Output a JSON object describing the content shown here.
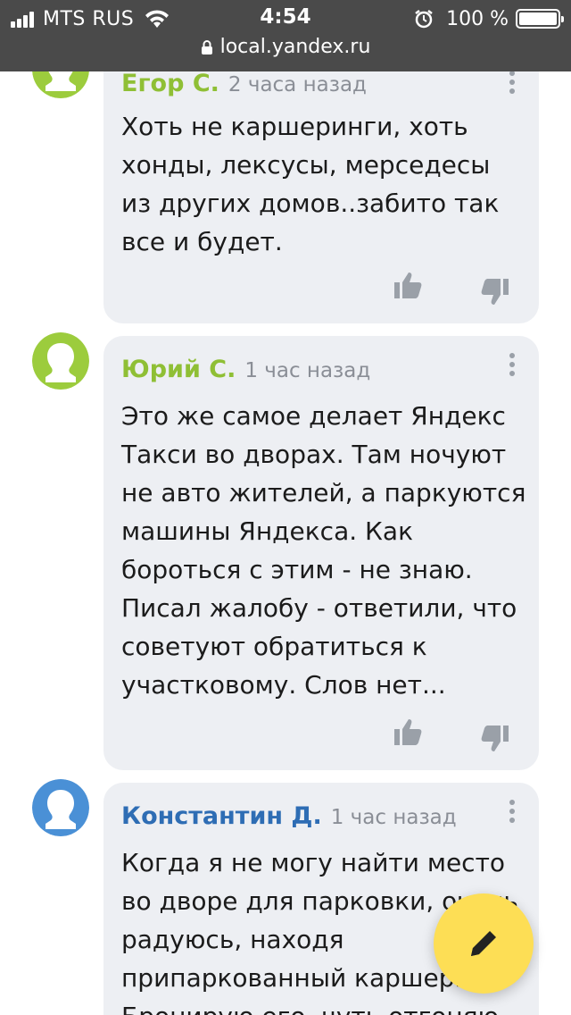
{
  "status_bar": {
    "carrier": "MTS RUS",
    "time": "4:54",
    "battery": "100 %"
  },
  "url_bar": {
    "url": "local.yandex.ru"
  },
  "comments": [
    {
      "author": "Егор С.",
      "age": "2 часа назад",
      "text": "Хоть не каршеринги, хоть\nхонды, лексусы, мерседесы\nиз других домов..забито так\nвсе и будет.",
      "avatar_color": "#9ccc3d",
      "author_color": "#8fbf35"
    },
    {
      "author": "Юрий С.",
      "age": "1 час назад",
      "text": "Это же самое делает Яндекс\nТакси во дворах. Там ночуют\nне авто жителей, а паркуются\nмашины Яндекса. Как\nбороться с этим - не знаю.\nПисал жалобу - ответили, что\nсоветуют обратиться к\nучастковому. Слов нет...",
      "avatar_color": "#9ccc3d",
      "author_color": "#8fbf35"
    },
    {
      "author": "Константин Д.",
      "age": "1 час назад",
      "text": "Когда я не могу найти место\nво дворе для парковки, очень\nрадуюсь, находя\nприпаркованный каршеринг.\nБронирую его, чуть отгоняю",
      "avatar_color": "#4a90d6",
      "author_color": "#2e6db4"
    }
  ],
  "icons": {
    "like": "thumbs-up-icon",
    "dislike": "thumbs-down-icon",
    "more": "more-vertical-icon",
    "fab": "pencil-icon"
  },
  "colors": {
    "status_bar_bg": "#4a4a4a",
    "card_bg": "#edeff3",
    "fab_bg": "#fdde55"
  }
}
